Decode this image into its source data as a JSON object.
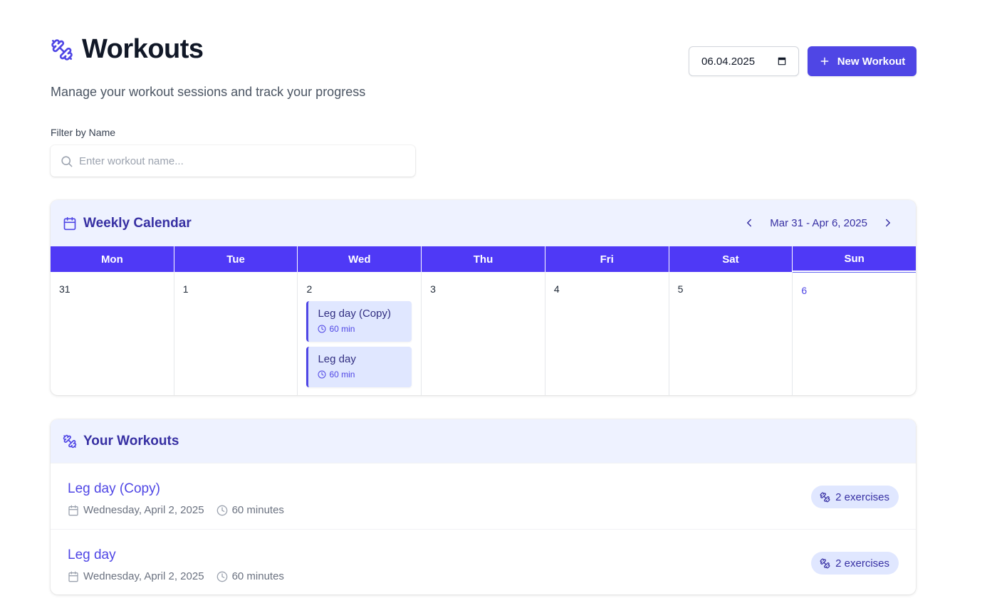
{
  "page": {
    "title": "Workouts",
    "subtitle": "Manage your workout sessions and track your progress"
  },
  "actions": {
    "date_value": "06.04.2025",
    "new_workout_label": "New Workout"
  },
  "filter": {
    "label": "Filter by Name",
    "placeholder": "Enter workout name..."
  },
  "calendar": {
    "title": "Weekly Calendar",
    "range": "Mar 31 - Apr 6, 2025",
    "days": [
      {
        "name": "Mon",
        "date": "31"
      },
      {
        "name": "Tue",
        "date": "1"
      },
      {
        "name": "Wed",
        "date": "2"
      },
      {
        "name": "Thu",
        "date": "3"
      },
      {
        "name": "Fri",
        "date": "4"
      },
      {
        "name": "Sat",
        "date": "5"
      },
      {
        "name": "Sun",
        "date": "6"
      }
    ],
    "events": [
      {
        "name": "Leg day (Copy)",
        "duration": "60 min"
      },
      {
        "name": "Leg day",
        "duration": "60 min"
      }
    ]
  },
  "workouts": {
    "title": "Your Workouts",
    "items": [
      {
        "name": "Leg day (Copy)",
        "date": "Wednesday, April 2, 2025",
        "duration": "60 minutes",
        "exercises": "2 exercises"
      },
      {
        "name": "Leg day",
        "date": "Wednesday, April 2, 2025",
        "duration": "60 minutes",
        "exercises": "2 exercises"
      }
    ]
  },
  "colors": {
    "accent": "#4f46e5",
    "header_bg": "#eef2ff",
    "day_header_bg": "#4f39f6",
    "event_bg": "#e0e7ff"
  },
  "icons": [
    "dumbbell-icon",
    "calendar-icon",
    "plus-icon",
    "search-icon",
    "chevron-left-icon",
    "chevron-right-icon",
    "clock-icon"
  ]
}
